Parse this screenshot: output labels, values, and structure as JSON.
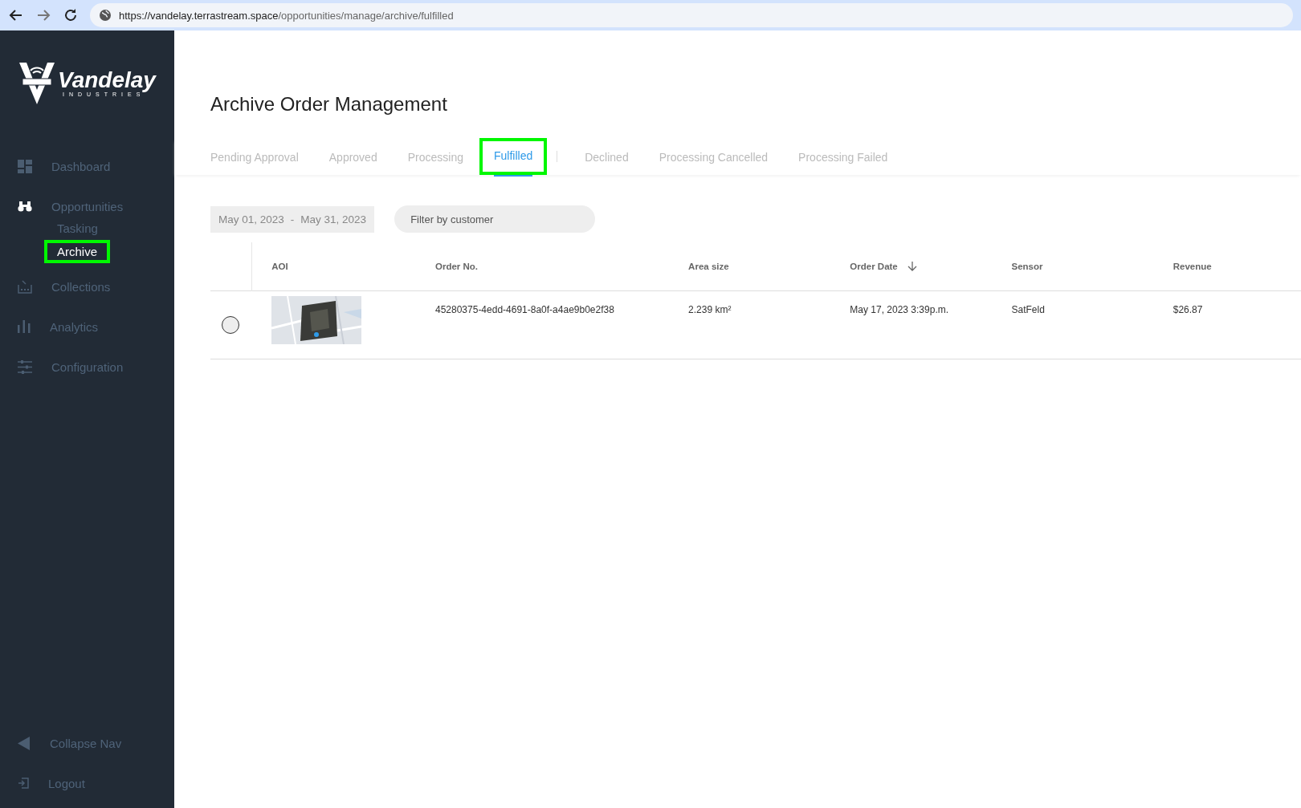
{
  "browser": {
    "url_host": "https://vandelay.terrastream.space",
    "url_path": "/opportunities/manage/archive/fulfilled"
  },
  "sidebar": {
    "logo": {
      "name": "Vandelay",
      "tagline": "INDUSTRIES"
    },
    "items": [
      {
        "kind": "dashboard",
        "label": "Dashboard"
      },
      {
        "kind": "binoculars",
        "label": "Opportunities",
        "children": [
          {
            "label": "Tasking",
            "selected": false,
            "highlighted": false
          },
          {
            "label": "Archive",
            "selected": true,
            "highlighted": true
          }
        ]
      },
      {
        "kind": "collections",
        "label": "Collections"
      },
      {
        "kind": "analytics",
        "label": "Analytics"
      },
      {
        "kind": "configuration",
        "label": "Configuration"
      }
    ],
    "footer": [
      {
        "kind": "collapse",
        "label": "Collapse Nav"
      },
      {
        "kind": "logout",
        "label": "Logout"
      }
    ]
  },
  "page": {
    "title": "Archive Order Management"
  },
  "tabs": [
    {
      "label": "Pending Approval",
      "selected": false,
      "highlighted": false,
      "divider_after": false
    },
    {
      "label": "Approved",
      "selected": false,
      "highlighted": false,
      "divider_after": false
    },
    {
      "label": "Processing",
      "selected": false,
      "highlighted": false,
      "divider_after": false
    },
    {
      "label": "Fulfilled",
      "selected": true,
      "highlighted": true,
      "divider_after": true
    },
    {
      "label": "Declined",
      "selected": false,
      "highlighted": false,
      "divider_after": false
    },
    {
      "label": "Processing Cancelled",
      "selected": false,
      "highlighted": false,
      "divider_after": false
    },
    {
      "label": "Processing Failed",
      "selected": false,
      "highlighted": false,
      "divider_after": false
    }
  ],
  "filters": {
    "date_from": "May 01, 2023",
    "date_sep": "-",
    "date_to": "May 31, 2023",
    "customer_placeholder": "Filter by customer"
  },
  "table": {
    "columns": [
      {
        "label": "AOI",
        "sorted": false
      },
      {
        "label": "Order No.",
        "sorted": false
      },
      {
        "label": "Area size",
        "sorted": false
      },
      {
        "label": "Order Date",
        "sorted": true
      },
      {
        "label": "Sensor",
        "sorted": false
      },
      {
        "label": "Revenue",
        "sorted": false
      }
    ],
    "rows": [
      {
        "selected": false,
        "order_no": "45280375-4edd-4691-8a0f-a4ae9b0e2f38",
        "area": "2.239 km²",
        "date": "May 17, 2023 3:39p.m.",
        "sensor": "SatFeld",
        "revenue": "$26.87"
      }
    ]
  }
}
